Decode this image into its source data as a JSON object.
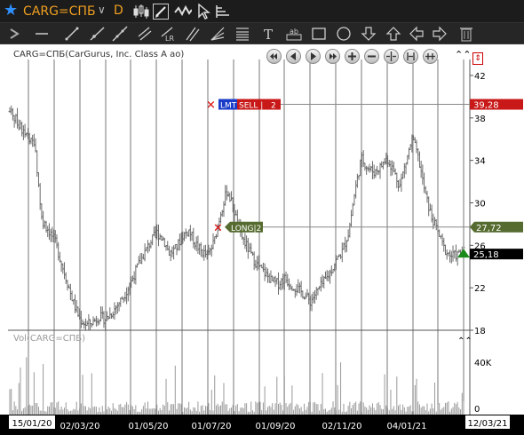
{
  "header": {
    "symbol": "CARG=СПБ",
    "period": "D"
  },
  "chart": {
    "title": "CARG=СПБ(CarGurus, Inc. Class A ao)",
    "volume_title": "Vol(CARG=СПБ)",
    "y_ticks": [
      "42",
      "38",
      "34",
      "30",
      "26",
      "22",
      "18"
    ],
    "vol_ticks": [
      "40K",
      "0"
    ],
    "x_ticks": [
      "02/03/20",
      "01/05/20",
      "01/07/20",
      "01/09/20",
      "02/11/20",
      "04/01/21"
    ],
    "start_date": "15/01/20",
    "end_date": "12/03/21",
    "orders": [
      {
        "type": "LMT",
        "side": "SELL",
        "qty": "2",
        "price": "39,28",
        "color": "#c81818"
      },
      {
        "side": "LONG",
        "qty": "2",
        "price": "27,72",
        "color": "#556b2f"
      }
    ],
    "last_price": "25,18"
  },
  "chart_data": {
    "type": "ohlc",
    "ylim": [
      18,
      42
    ],
    "series": [
      {
        "name": "CARG=СПБ",
        "values": [
          38.6,
          37.8,
          36.8,
          36.0,
          35.0,
          28.5,
          27.5,
          26.5,
          24.5,
          22.5,
          20.5,
          19.0,
          18.5,
          18.8,
          19.3,
          19.0,
          19.7,
          20.5,
          21.4,
          22.6,
          24.0,
          25.2,
          26.3,
          27.2,
          26.6,
          25.2,
          25.7,
          26.9,
          27.4,
          26.2,
          25.4,
          25.0,
          26.4,
          29.1,
          31.2,
          29.5,
          27.1,
          26.0,
          24.8,
          23.9,
          23.3,
          22.6,
          22.4,
          22.9,
          22.3,
          21.9,
          21.4,
          20.7,
          21.6,
          22.4,
          23.3,
          24.5,
          25.4,
          27.2,
          31.1,
          34.2,
          33.3,
          32.9,
          33.4,
          34.2,
          33.1,
          31.6,
          33.9,
          36.1,
          34.0,
          30.8,
          28.6,
          27.2,
          25.6,
          25.0,
          25.1,
          25.4
        ]
      }
    ]
  }
}
